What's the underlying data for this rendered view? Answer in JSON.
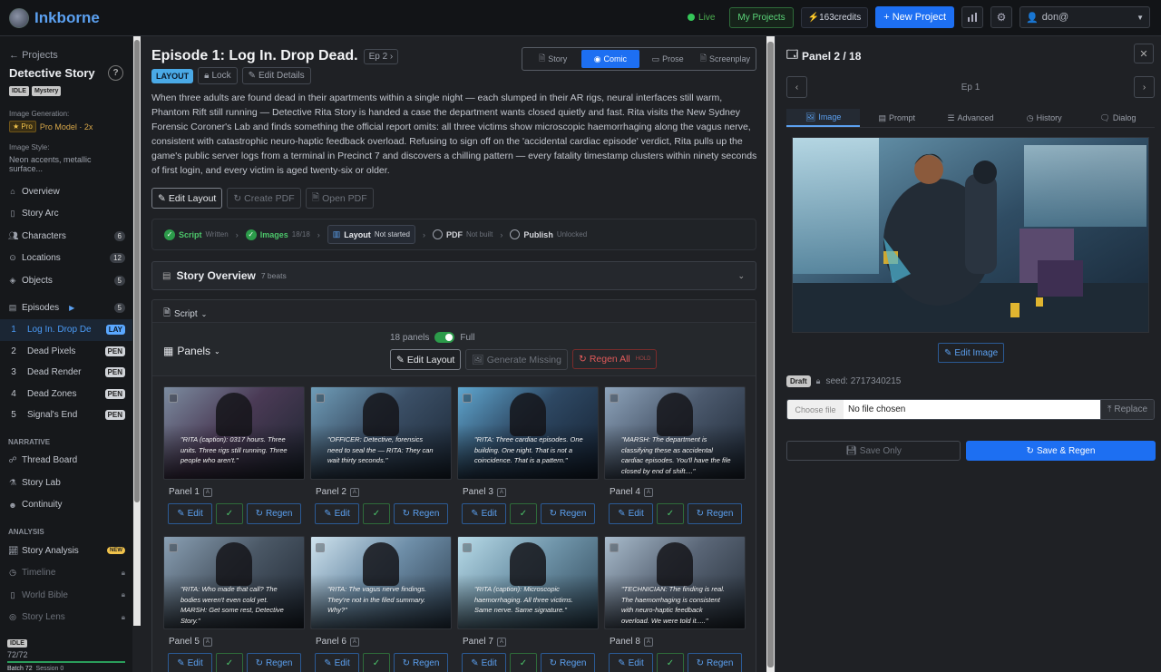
{
  "app": {
    "name": "Inkborne"
  },
  "topbar": {
    "live": "Live",
    "my_projects": "My Projects",
    "credits": "163credits",
    "new_project": "+ New Project",
    "user": "don@"
  },
  "sidebar": {
    "back": "Projects",
    "project_title": "Detective Story",
    "help": "?",
    "tags": [
      "IDLE",
      "Mystery"
    ],
    "image_gen_label": "Image Generation:",
    "pro_badge": "Pro",
    "pro_model": "Pro Model · 2x",
    "image_style_label": "Image Style:",
    "image_style_value": "Neon accents, metallic surface...",
    "nav": [
      {
        "label": "Overview",
        "icon": "home-icon"
      },
      {
        "label": "Story Arc",
        "icon": "book-icon"
      },
      {
        "label": "Characters",
        "icon": "users-icon",
        "count": "6"
      },
      {
        "label": "Locations",
        "icon": "pin-icon",
        "count": "12"
      },
      {
        "label": "Objects",
        "icon": "box-icon",
        "count": "5"
      }
    ],
    "episodes_label": "Episodes",
    "episodes_count": "5",
    "episodes": [
      {
        "num": "1",
        "title": "Log In. Drop De",
        "tag": "LAY",
        "active": true
      },
      {
        "num": "2",
        "title": "Dead Pixels",
        "tag": "PEN"
      },
      {
        "num": "3",
        "title": "Dead Render",
        "tag": "PEN"
      },
      {
        "num": "4",
        "title": "Dead Zones",
        "tag": "PEN"
      },
      {
        "num": "5",
        "title": "Signal's End",
        "tag": "PEN"
      }
    ],
    "narrative_label": "NARRATIVE",
    "narrative": [
      {
        "label": "Thread Board",
        "icon": "thread-icon"
      },
      {
        "label": "Story Lab",
        "icon": "flask-icon"
      },
      {
        "label": "Continuity",
        "icon": "person-icon"
      }
    ],
    "analysis_label": "ANALYSIS",
    "analysis": [
      {
        "label": "Story Analysis",
        "icon": "chart-icon",
        "badge": "NEW"
      },
      {
        "label": "Timeline",
        "icon": "clock-icon",
        "locked": true
      },
      {
        "label": "World Bible",
        "icon": "book-icon",
        "locked": true
      },
      {
        "label": "Story Lens",
        "icon": "lens-icon",
        "locked": true
      }
    ],
    "footer": {
      "status": "IDLE",
      "progress_text": "72/72",
      "batch": "Batch 72",
      "session": "Session 0"
    }
  },
  "episode": {
    "title": "Episode 1: Log In. Drop Dead.",
    "ep_label": "Ep 2",
    "layout_badge": "LAYOUT",
    "lock": "Lock",
    "edit_details": "Edit Details",
    "modes": [
      "Story",
      "Comic",
      "Prose",
      "Screenplay"
    ],
    "active_mode": "Comic",
    "synopsis": "When three adults are found dead in their apartments within a single night — each slumped in their AR rigs, neural interfaces still warm, Phantom Rift still running — Detective Rita Story is handed a case the department wants closed quietly and fast. Rita visits the New Sydney Forensic Coroner's Lab and finds something the official report omits: all three victims show microscopic haemorrhaging along the vagus nerve, consistent with catastrophic neuro-haptic feedback overload. Refusing to sign off on the 'accidental cardiac episode' verdict, Rita pulls up the game's public server logs from a terminal in Precinct 7 and discovers a chilling pattern — every fatality timestamp clusters within ninety seconds of first login, and every victim is aged twenty-six or older.",
    "edit_layout": "Edit Layout",
    "create_pdf": "Create PDF",
    "open_pdf": "Open PDF"
  },
  "pipeline": [
    {
      "name": "Script",
      "status": "Written",
      "state": "done"
    },
    {
      "name": "Images",
      "status": "18/18",
      "state": "done"
    },
    {
      "name": "Layout",
      "status": "Not started",
      "state": "current"
    },
    {
      "name": "PDF",
      "status": "Not built",
      "state": "todo"
    },
    {
      "name": "Publish",
      "status": "Unlocked",
      "state": "todo"
    }
  ],
  "overview": {
    "title": "Story Overview",
    "beats": "7 beats"
  },
  "panels_section": {
    "script_label": "Script",
    "panels_label": "Panels",
    "count": "18 panels",
    "full_label": "Full",
    "edit_layout": "Edit Layout",
    "generate_missing": "Generate Missing",
    "regen_all": "Regen All",
    "regen_hold": "HOLD"
  },
  "panels": [
    {
      "label": "Panel 1",
      "caption": "\"RITA (caption): 0317 hours. Three units. Three rigs still running. Three people who aren't.\""
    },
    {
      "label": "Panel 2",
      "caption": "\"OFFICER: Detective, forensics need to seal the — RITA: They can wait thirty seconds.\""
    },
    {
      "label": "Panel 3",
      "caption": "\"RITA: Three cardiac episodes. One building. One night. That is not a coincidence. That is a pattern.\""
    },
    {
      "label": "Panel 4",
      "caption": "\"MARSH: The department is classifying these as accidental cardiac episodes. You'll have the file closed by end of shift....\""
    },
    {
      "label": "Panel 5",
      "caption": "\"RITA: Who made that call? The bodies weren't even cold yet. MARSH: Get some rest, Detective Story.\""
    },
    {
      "label": "Panel 6",
      "caption": "\"RITA: The vagus nerve findings. They're not in the filed summary. Why?\""
    },
    {
      "label": "Panel 7",
      "caption": "\"RITA (caption): Microscopic haemorrhaging. All three victims. Same nerve. Same signature.\""
    },
    {
      "label": "Panel 8",
      "caption": "\"TECHNICIAN: The finding is real. The haemorrhaging is consistent with neuro-haptic feedback overload. We were told it.....\""
    }
  ],
  "panel_buttons": {
    "edit": "Edit",
    "regen": "Regen"
  },
  "right_panel": {
    "title": "Panel 2 / 18",
    "ep": "Ep 1",
    "tabs": [
      "Image",
      "Prompt",
      "Advanced",
      "History",
      "Dialog"
    ],
    "active_tab": "Image",
    "edit_image": "Edit Image",
    "draft": "Draft",
    "seed": "seed: 2717340215",
    "choose_file": "Choose file",
    "no_file": "No file chosen",
    "replace": "Replace",
    "save_only": "Save Only",
    "save_regen": "Save & Regen"
  }
}
